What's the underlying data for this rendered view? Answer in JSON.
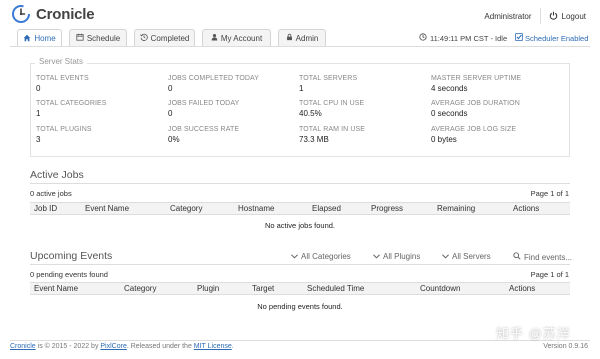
{
  "app": {
    "name": "Cronicle"
  },
  "user": {
    "name": "Administrator",
    "logout_label": "Logout"
  },
  "tabs": [
    {
      "label": "Home",
      "icon": "home-icon"
    },
    {
      "label": "Schedule",
      "icon": "calendar-icon"
    },
    {
      "label": "Completed",
      "icon": "history-icon"
    },
    {
      "label": "My Account",
      "icon": "user-icon"
    },
    {
      "label": "Admin",
      "icon": "lock-icon"
    }
  ],
  "status": {
    "clock": "11:49:11 PM CST - Idle",
    "scheduler": "Scheduler Enabled"
  },
  "server_stats": {
    "legend": "Server Stats",
    "items": [
      {
        "label": "Total Events",
        "value": "0"
      },
      {
        "label": "Jobs Completed Today",
        "value": "0"
      },
      {
        "label": "Total Servers",
        "value": "1"
      },
      {
        "label": "Master Server Uptime",
        "value": "4 seconds"
      },
      {
        "label": "Total Categories",
        "value": "1"
      },
      {
        "label": "Jobs Failed Today",
        "value": "0"
      },
      {
        "label": "Total CPU in Use",
        "value": "40.5%"
      },
      {
        "label": "Average Job Duration",
        "value": "0 seconds"
      },
      {
        "label": "Total Plugins",
        "value": "3"
      },
      {
        "label": "Job Success Rate",
        "value": "0%"
      },
      {
        "label": "Total RAM in Use",
        "value": "73.3 MB"
      },
      {
        "label": "Average Job Log Size",
        "value": "0 bytes"
      }
    ]
  },
  "active_jobs": {
    "title": "Active Jobs",
    "count": "0 active jobs",
    "page": "Page 1 of 1",
    "columns": [
      "Job ID",
      "Event Name",
      "Category",
      "Hostname",
      "Elapsed",
      "Progress",
      "Remaining",
      "Actions"
    ],
    "empty": "No active jobs found."
  },
  "upcoming_events": {
    "title": "Upcoming Events",
    "count": "0 pending events found",
    "page": "Page 1 of 1",
    "filters": {
      "categories": "All Categories",
      "plugins": "All Plugins",
      "servers": "All Servers",
      "search": "Find events..."
    },
    "columns": [
      "Event Name",
      "Category",
      "Plugin",
      "Target",
      "Scheduled Time",
      "Countdown",
      "Actions"
    ],
    "empty": "No pending events found."
  },
  "footer": {
    "app_link": "Cronicle",
    "text1": " is © 2015 - 2022 by ",
    "org_link": "PixlCore",
    "text2": ". Released under the ",
    "license_link": "MIT License",
    "text3": ".",
    "version": "Version 0.9.16"
  },
  "watermark": "知乎 @苏洋",
  "colors": {
    "accent": "#2d6cb5",
    "border": "#dddddd",
    "header_bg": "#f3f3f3"
  }
}
